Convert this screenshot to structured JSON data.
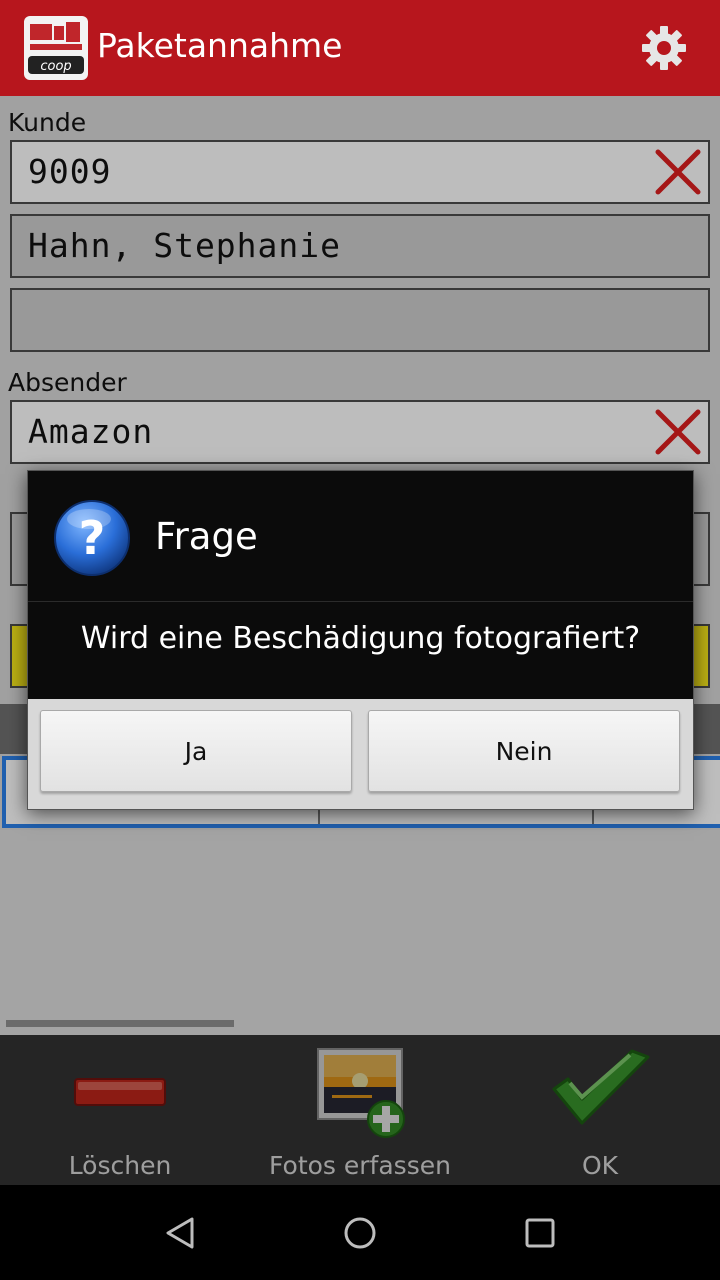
{
  "app": {
    "title": "Paketannahme",
    "brand_color": "#b7161d",
    "logo_icon": "coop-logo-icon",
    "settings_icon": "gear-icon"
  },
  "form": {
    "kunde_label": "Kunde",
    "kunde_number": "9009",
    "kunde_name": "Hahn, Stephanie",
    "kunde_extra": "",
    "absender_label": "Absender",
    "absender_value": "Amazon",
    "clear_icon": "close-x-icon"
  },
  "dialog": {
    "title": "Frage",
    "icon": "question-icon",
    "message": "Wird eine Beschädigung fotografiert?",
    "yes_label": "Ja",
    "no_label": "Nein"
  },
  "toolbar": {
    "delete_label": "Löschen",
    "photos_label": "Fotos erfassen",
    "ok_label": "OK"
  },
  "navbar": {
    "back_icon": "back-triangle-icon",
    "home_icon": "home-circle-icon",
    "recents_icon": "recents-square-icon"
  }
}
